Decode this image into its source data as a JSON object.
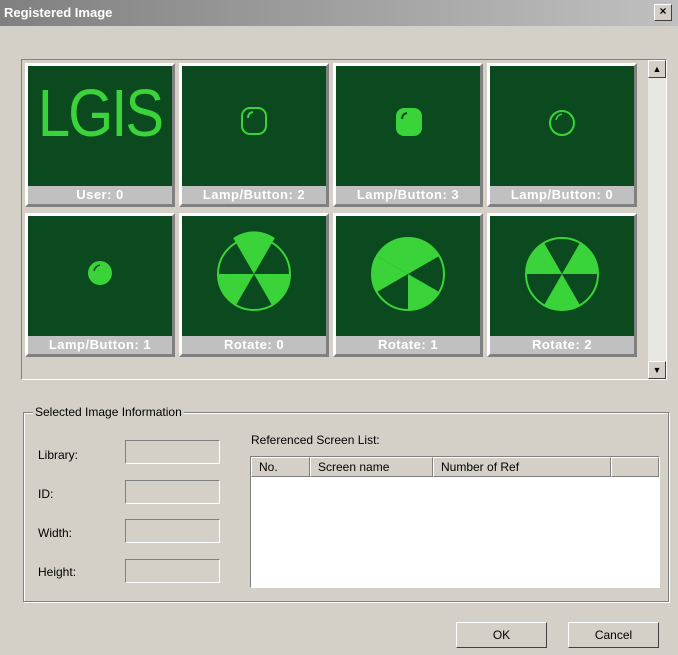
{
  "window": {
    "title": "Registered Image",
    "close_symbol": "×"
  },
  "gallery": {
    "tiles": [
      {
        "caption": "User: 0",
        "image": "lgis-text",
        "text": "LGIS"
      },
      {
        "caption": "Lamp/Button: 2",
        "image": "lamp-outline-icon"
      },
      {
        "caption": "Lamp/Button: 3",
        "image": "lamp-filled-icon"
      },
      {
        "caption": "Lamp/Button: 0",
        "image": "lamp-outline-small-icon"
      },
      {
        "caption": "Lamp/Button: 1",
        "image": "lamp-on-icon"
      },
      {
        "caption": "Rotate: 0",
        "image": "rotate-icon"
      },
      {
        "caption": "Rotate: 1",
        "image": "rotate-icon"
      },
      {
        "caption": "Rotate: 2",
        "image": "rotate-icon"
      }
    ],
    "scroll_up": "▲",
    "scroll_down": "▼"
  },
  "info": {
    "legend": "Selected Image Information",
    "fields": [
      {
        "label": "Library:",
        "value": ""
      },
      {
        "label": "ID:",
        "value": ""
      },
      {
        "label": "Width:",
        "value": ""
      },
      {
        "label": "Height:",
        "value": ""
      }
    ],
    "list_title": "Referenced Screen List:",
    "columns": [
      "No.",
      "Screen name",
      "Number of Ref",
      ""
    ]
  },
  "buttons": {
    "ok": "OK",
    "cancel": "Cancel"
  },
  "colors": {
    "tile_bg": "#0a4a1e",
    "lamp_green": "#3ad43a"
  }
}
